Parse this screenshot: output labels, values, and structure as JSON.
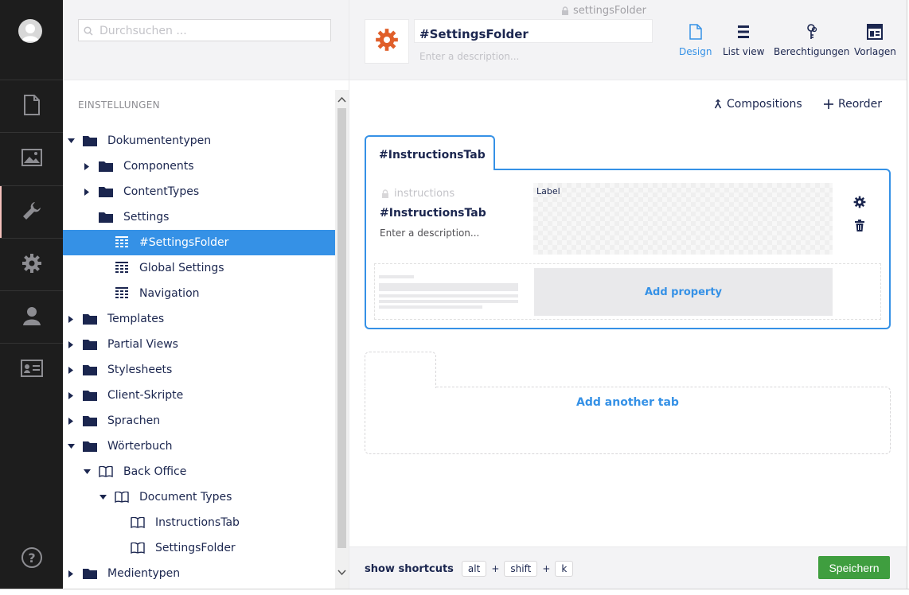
{
  "search": {
    "placeholder": "Durchsuchen ..."
  },
  "tree": {
    "section_title": "EINSTELLUNGEN",
    "items": [
      {
        "label": "Dokumententypen",
        "icon": "folder-icon",
        "caret": "down"
      },
      {
        "label": "Components",
        "icon": "folder-icon",
        "caret": "right"
      },
      {
        "label": "ContentTypes",
        "icon": "folder-icon",
        "caret": "right"
      },
      {
        "label": "Settings",
        "icon": "folder-icon",
        "caret": "none"
      },
      {
        "label": "#SettingsFolder",
        "icon": "grid-icon",
        "caret": "none",
        "selected": true
      },
      {
        "label": "Global Settings",
        "icon": "grid-icon",
        "caret": "none"
      },
      {
        "label": "Navigation",
        "icon": "grid-icon",
        "caret": "none"
      },
      {
        "label": "Templates",
        "icon": "folder-icon",
        "caret": "right"
      },
      {
        "label": "Partial Views",
        "icon": "folder-icon",
        "caret": "right"
      },
      {
        "label": "Stylesheets",
        "icon": "folder-icon",
        "caret": "right"
      },
      {
        "label": "Client-Skripte",
        "icon": "folder-icon",
        "caret": "right"
      },
      {
        "label": "Sprachen",
        "icon": "folder-icon",
        "caret": "right"
      },
      {
        "label": "Wörterbuch",
        "icon": "folder-icon",
        "caret": "down"
      },
      {
        "label": "Back Office",
        "icon": "book-icon",
        "caret": "down"
      },
      {
        "label": "Document Types",
        "icon": "book-icon",
        "caret": "down"
      },
      {
        "label": "InstructionsTab",
        "icon": "book-icon",
        "caret": "none"
      },
      {
        "label": "SettingsFolder",
        "icon": "book-icon",
        "caret": "none"
      },
      {
        "label": "Medientypen",
        "icon": "folder-icon",
        "caret": "right"
      }
    ]
  },
  "header": {
    "name": "#SettingsFolder",
    "alias": "settingsFolder",
    "description_placeholder": "Enter a description...",
    "buttons": {
      "design": "Design",
      "list_view": "List view",
      "permissions": "Berechtigungen",
      "templates": "Vorlagen"
    }
  },
  "toolbar": {
    "compositions": "Compositions",
    "reorder": "Reorder"
  },
  "tab": {
    "title": "#InstructionsTab",
    "alias": "instructions",
    "name": "#InstructionsTab",
    "description_placeholder": "Enter a description...",
    "label": "Label",
    "add_property": "Add property"
  },
  "add_tab": "Add another tab",
  "footer": {
    "shortcuts_label": "show shortcuts",
    "keys": [
      "alt",
      "shift",
      "k"
    ],
    "save": "Speichern"
  },
  "colors": {
    "accent": "#3591e6",
    "nav_bg": "#1d1d1d",
    "save": "#3f9e3f",
    "doc_icon": "#e05f2a"
  }
}
